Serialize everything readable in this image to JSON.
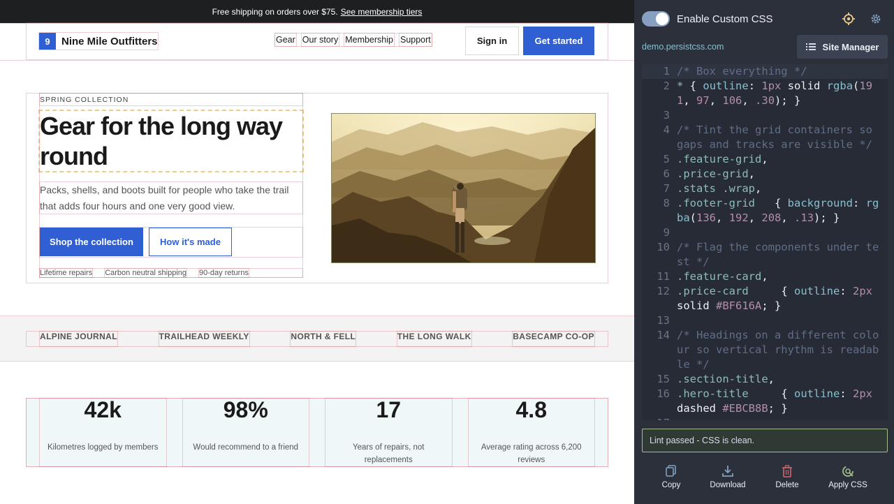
{
  "site": {
    "banner": {
      "text": "Free shipping on orders over $75.",
      "link": "See membership tiers"
    },
    "brand": {
      "mark": "9",
      "name": "Nine Mile Outfitters"
    },
    "nav": [
      "Gear",
      "Our story",
      "Membership",
      "Support"
    ],
    "header_buttons": {
      "signin": "Sign in",
      "start": "Get started"
    },
    "hero": {
      "eyebrow": "SPRING COLLECTION",
      "title": "Gear for the long way round",
      "subtitle": "Packs, shells, and boots built for people who take the trail that adds four hours and one very good view.",
      "primary_cta": "Shop the collection",
      "secondary_cta": "How it's made",
      "perks": [
        "Lifetime repairs",
        "Carbon neutral shipping",
        "90-day returns"
      ]
    },
    "logos": [
      "ALPINE JOURNAL",
      "TRAILHEAD WEEKLY",
      "NORTH & FELL",
      "THE LONG WALK",
      "BASECAMP CO-OP"
    ],
    "stats": [
      {
        "value": "42k",
        "label": "Kilometres logged by members"
      },
      {
        "value": "98%",
        "label": "Would recommend to a friend"
      },
      {
        "value": "17",
        "label": "Years of repairs, not replacements"
      },
      {
        "value": "4.8",
        "label": "Average rating across 6,200 reviews"
      }
    ]
  },
  "panel": {
    "title": "Enable Custom CSS",
    "toggle_on": true,
    "domain": "demo.persistcss.com",
    "site_manager": "Site Manager",
    "lint": "Lint passed - CSS is clean.",
    "actions": {
      "copy": "Copy",
      "download": "Download",
      "delete": "Delete",
      "apply": "Apply CSS"
    },
    "code_lines": [
      "/* Box everything */",
      "* { outline: 1px solid rgba(191, 97, 106, .30); }",
      "",
      "/* Tint the grid containers so gaps and tracks are visible */",
      ".feature-grid,",
      ".price-grid,",
      ".stats .wrap,",
      ".footer-grid   { background: rgba(136, 192, 208, .13); }",
      "",
      "/* Flag the components under test */",
      ".feature-card,",
      ".price-card     { outline: 2px solid #BF616A; }",
      "",
      "/* Headings on a different colour so vertical rhythm is readable */",
      ".section-title,",
      ".hero-title     { outline: 2px dashed #EBCB8B; }",
      ""
    ]
  },
  "colors": {
    "accent": "#2f5fd3",
    "panel_bg": "#2b303b",
    "lint_border": "#a3be8c",
    "dashed_outline": "#EBCB8B"
  },
  "icons": [
    "locate-icon",
    "gear-icon",
    "list-icon",
    "copy-icon",
    "download-icon",
    "trash-icon",
    "apply-icon"
  ]
}
